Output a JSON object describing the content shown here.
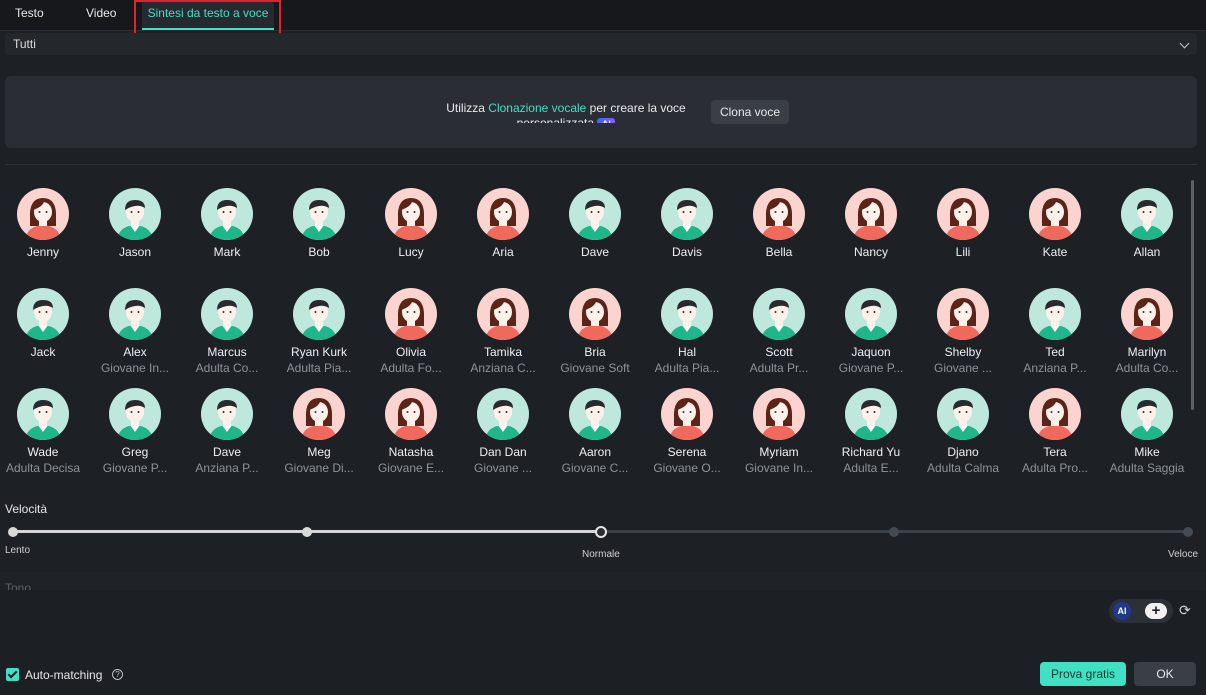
{
  "tabs": [
    {
      "label": "Testo"
    },
    {
      "label": "Video"
    },
    {
      "label": "Sintesi da testo a voce",
      "active": true
    }
  ],
  "filter": {
    "value": "Tutti"
  },
  "clone": {
    "text_prefix": "Utilizza ",
    "text_link": "Clonazione vocale",
    "text_suffix": " per creare la voce personalizzata",
    "ai_badge": "AI",
    "button": "Clona voce"
  },
  "voices": [
    {
      "name": "Jenny",
      "desc": "",
      "gender": "female"
    },
    {
      "name": "Jason",
      "desc": "",
      "gender": "male"
    },
    {
      "name": "Mark",
      "desc": "",
      "gender": "male"
    },
    {
      "name": "Bob",
      "desc": "",
      "gender": "male"
    },
    {
      "name": "Lucy",
      "desc": "",
      "gender": "female"
    },
    {
      "name": "Aria",
      "desc": "",
      "gender": "female"
    },
    {
      "name": "Dave",
      "desc": "",
      "gender": "male"
    },
    {
      "name": "Davis",
      "desc": "",
      "gender": "male"
    },
    {
      "name": "Bella",
      "desc": "",
      "gender": "female"
    },
    {
      "name": "Nancy",
      "desc": "",
      "gender": "female"
    },
    {
      "name": "Lili",
      "desc": "",
      "gender": "female"
    },
    {
      "name": "Kate",
      "desc": "",
      "gender": "female"
    },
    {
      "name": "Allan",
      "desc": "",
      "gender": "male"
    },
    {
      "name": "Jack",
      "desc": "",
      "gender": "male"
    },
    {
      "name": "Alex",
      "desc": "Giovane In...",
      "gender": "male"
    },
    {
      "name": "Marcus",
      "desc": "Adulta Co...",
      "gender": "male"
    },
    {
      "name": "Ryan Kurk",
      "desc": "Adulta Pia...",
      "gender": "male"
    },
    {
      "name": "Olivia",
      "desc": "Adulta Fo...",
      "gender": "female"
    },
    {
      "name": "Tamika",
      "desc": "Anziana C...",
      "gender": "female"
    },
    {
      "name": "Bria",
      "desc": "Giovane Soft",
      "gender": "female"
    },
    {
      "name": "Hal",
      "desc": "Adulta Pia...",
      "gender": "male"
    },
    {
      "name": "Scott",
      "desc": "Adulta Pr...",
      "gender": "male"
    },
    {
      "name": "Jaquon",
      "desc": "Giovane P...",
      "gender": "male"
    },
    {
      "name": "Shelby",
      "desc": "Giovane ...",
      "gender": "female"
    },
    {
      "name": "Ted",
      "desc": "Anziana P...",
      "gender": "male"
    },
    {
      "name": "Marilyn",
      "desc": "Adulta Co...",
      "gender": "female"
    },
    {
      "name": "Wade",
      "desc": "Adulta Decisa",
      "gender": "male"
    },
    {
      "name": "Greg",
      "desc": "Giovane P...",
      "gender": "male"
    },
    {
      "name": "Dave",
      "desc": "Anziana P...",
      "gender": "male"
    },
    {
      "name": "Meg",
      "desc": "Giovane Di...",
      "gender": "female"
    },
    {
      "name": "Natasha",
      "desc": "Giovane E...",
      "gender": "female"
    },
    {
      "name": "Dan Dan",
      "desc": "Giovane ...",
      "gender": "male"
    },
    {
      "name": "Aaron",
      "desc": "Giovane C...",
      "gender": "male"
    },
    {
      "name": "Serena",
      "desc": "Giovane O...",
      "gender": "female"
    },
    {
      "name": "Myriam",
      "desc": "Giovane In...",
      "gender": "female"
    },
    {
      "name": "Richard Yu",
      "desc": "Adulta E...",
      "gender": "male"
    },
    {
      "name": "Djano",
      "desc": "Adulta Calma",
      "gender": "male"
    },
    {
      "name": "Tera",
      "desc": "Adulta Pro...",
      "gender": "female"
    },
    {
      "name": "Mike",
      "desc": "Adulta Saggia",
      "gender": "male"
    }
  ],
  "speed": {
    "label": "Velocità",
    "min_label": "Lento",
    "mid_label": "Normale",
    "max_label": "Veloce",
    "steps": 5,
    "value_index": 2
  },
  "tone": {
    "label": "Tono"
  },
  "tools": {
    "ai_label": "AI",
    "plus": "+",
    "refresh": "⟳"
  },
  "auto_matching": {
    "label": "Auto-matching",
    "checked": true,
    "help": "?"
  },
  "buttons": {
    "try": "Prova gratis",
    "ok": "OK"
  },
  "colors": {
    "accent": "#41e0c2",
    "highlight_border": "#e0222a",
    "female_bg": "#fbd4d0",
    "male_bg": "#bfe8dc",
    "female_body": "#ef6a5d",
    "male_body": "#1fb789"
  }
}
